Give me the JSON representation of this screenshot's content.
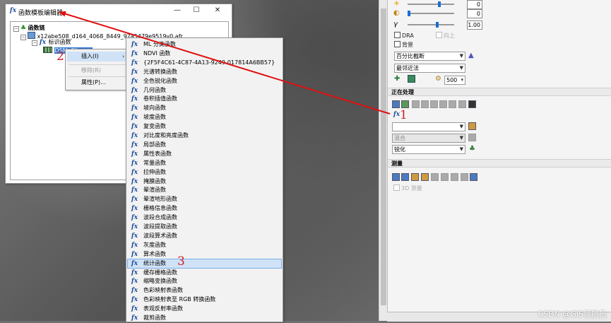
{
  "window": {
    "title": "函数模板编辑器",
    "controls": {
      "minimize": "—",
      "maximize": "☐",
      "close": "✕"
    }
  },
  "tree": {
    "root_label": "函数链",
    "file_label": "x12abe508_d164_4068_8449_97a5479e9519v0.afr",
    "func_label": "标识函数",
    "raster_label": "DSM_Clip.mo"
  },
  "context_menu": {
    "items": [
      {
        "label": "插入(I)",
        "arrow": "›"
      },
      {
        "label": "移除(R)"
      },
      {
        "label": "属性(P)..."
      }
    ]
  },
  "submenu": {
    "items": [
      "ML 分类函数",
      "NDVI 函数",
      "{2F5F4C61-4C87-4A13-9249-017814A6BB57}",
      "光谱转换函数",
      "全色锐化函数",
      "几何函数",
      "卷积插值函数",
      "坡向函数",
      "坡度函数",
      "复变函数",
      "对比度和亮度函数",
      "局部函数",
      "属性表函数",
      "常量函数",
      "拉伸函数",
      "掩膜函数",
      "晕渲函数",
      "晕渲地形函数",
      "栅格信息函数",
      "波段合成函数",
      "波段提取函数",
      "波段算术函数",
      "灰度函数",
      "算术函数",
      "统计函数",
      "缓存栅格函数",
      "缩略变换函数",
      "色彩映射表函数",
      "色彩映射表至 RGB 转换函数",
      "表观反射率函数",
      "裁剪函数"
    ],
    "highlighted_index": 24
  },
  "panel": {
    "slider_values": [
      "0",
      "0",
      "1.00"
    ],
    "gamma_symbol": "γ",
    "dra_label": "DRA",
    "above_label": "向上",
    "background_label": "背景",
    "stretch_select": "百分比截断",
    "resample_select": "最邻近法",
    "zoom_value": "500",
    "section_processing": "正在处理",
    "mix_select": "混合",
    "sharpen_select": "锐化",
    "section_measure": "测量",
    "measure_3d_label": "3D 测量"
  },
  "annotations": {
    "n1": "1",
    "n2": "2",
    "n3": "3"
  },
  "watermark": "CSDN @GIS领航员",
  "colors": {
    "arrow": "#e01010",
    "highlight": "#cfe2f7",
    "selection": "#3178d0"
  }
}
